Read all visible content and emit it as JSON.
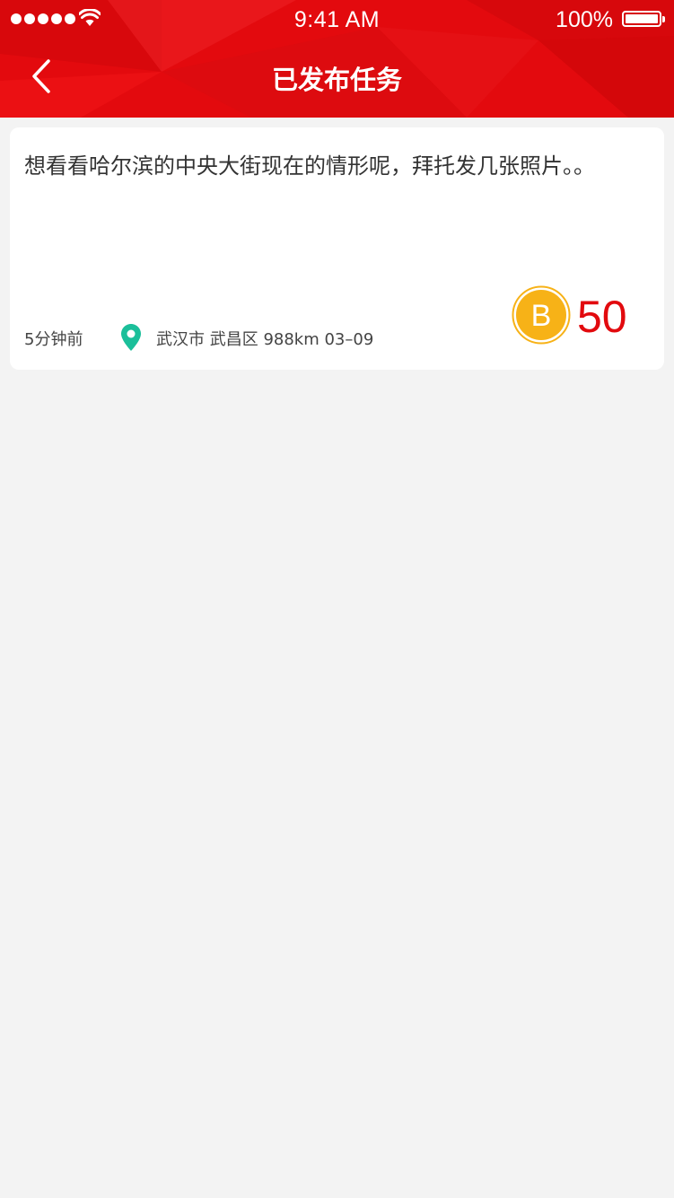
{
  "status_bar": {
    "time": "9:41 AM",
    "battery_percent": "100%",
    "icons": [
      "signal-dots-icon",
      "wifi-icon",
      "battery-icon"
    ]
  },
  "navbar": {
    "title": "已发布任务",
    "back_icon": "chevron-left-icon",
    "background_color": "#e20a0e"
  },
  "task": {
    "description": "想看看哈尔滨的中央大街现在的情形呢，拜托发几张照片。。",
    "posted_ago": "5分钟前",
    "location": "武汉市 武昌区 988km  03–09",
    "location_icon": "map-pin-icon",
    "reward_icon": "coin-b-icon",
    "reward": "50",
    "reward_color": "#e20a0e",
    "pin_color": "#1bbf9a",
    "coin_color": "#f7b217"
  }
}
